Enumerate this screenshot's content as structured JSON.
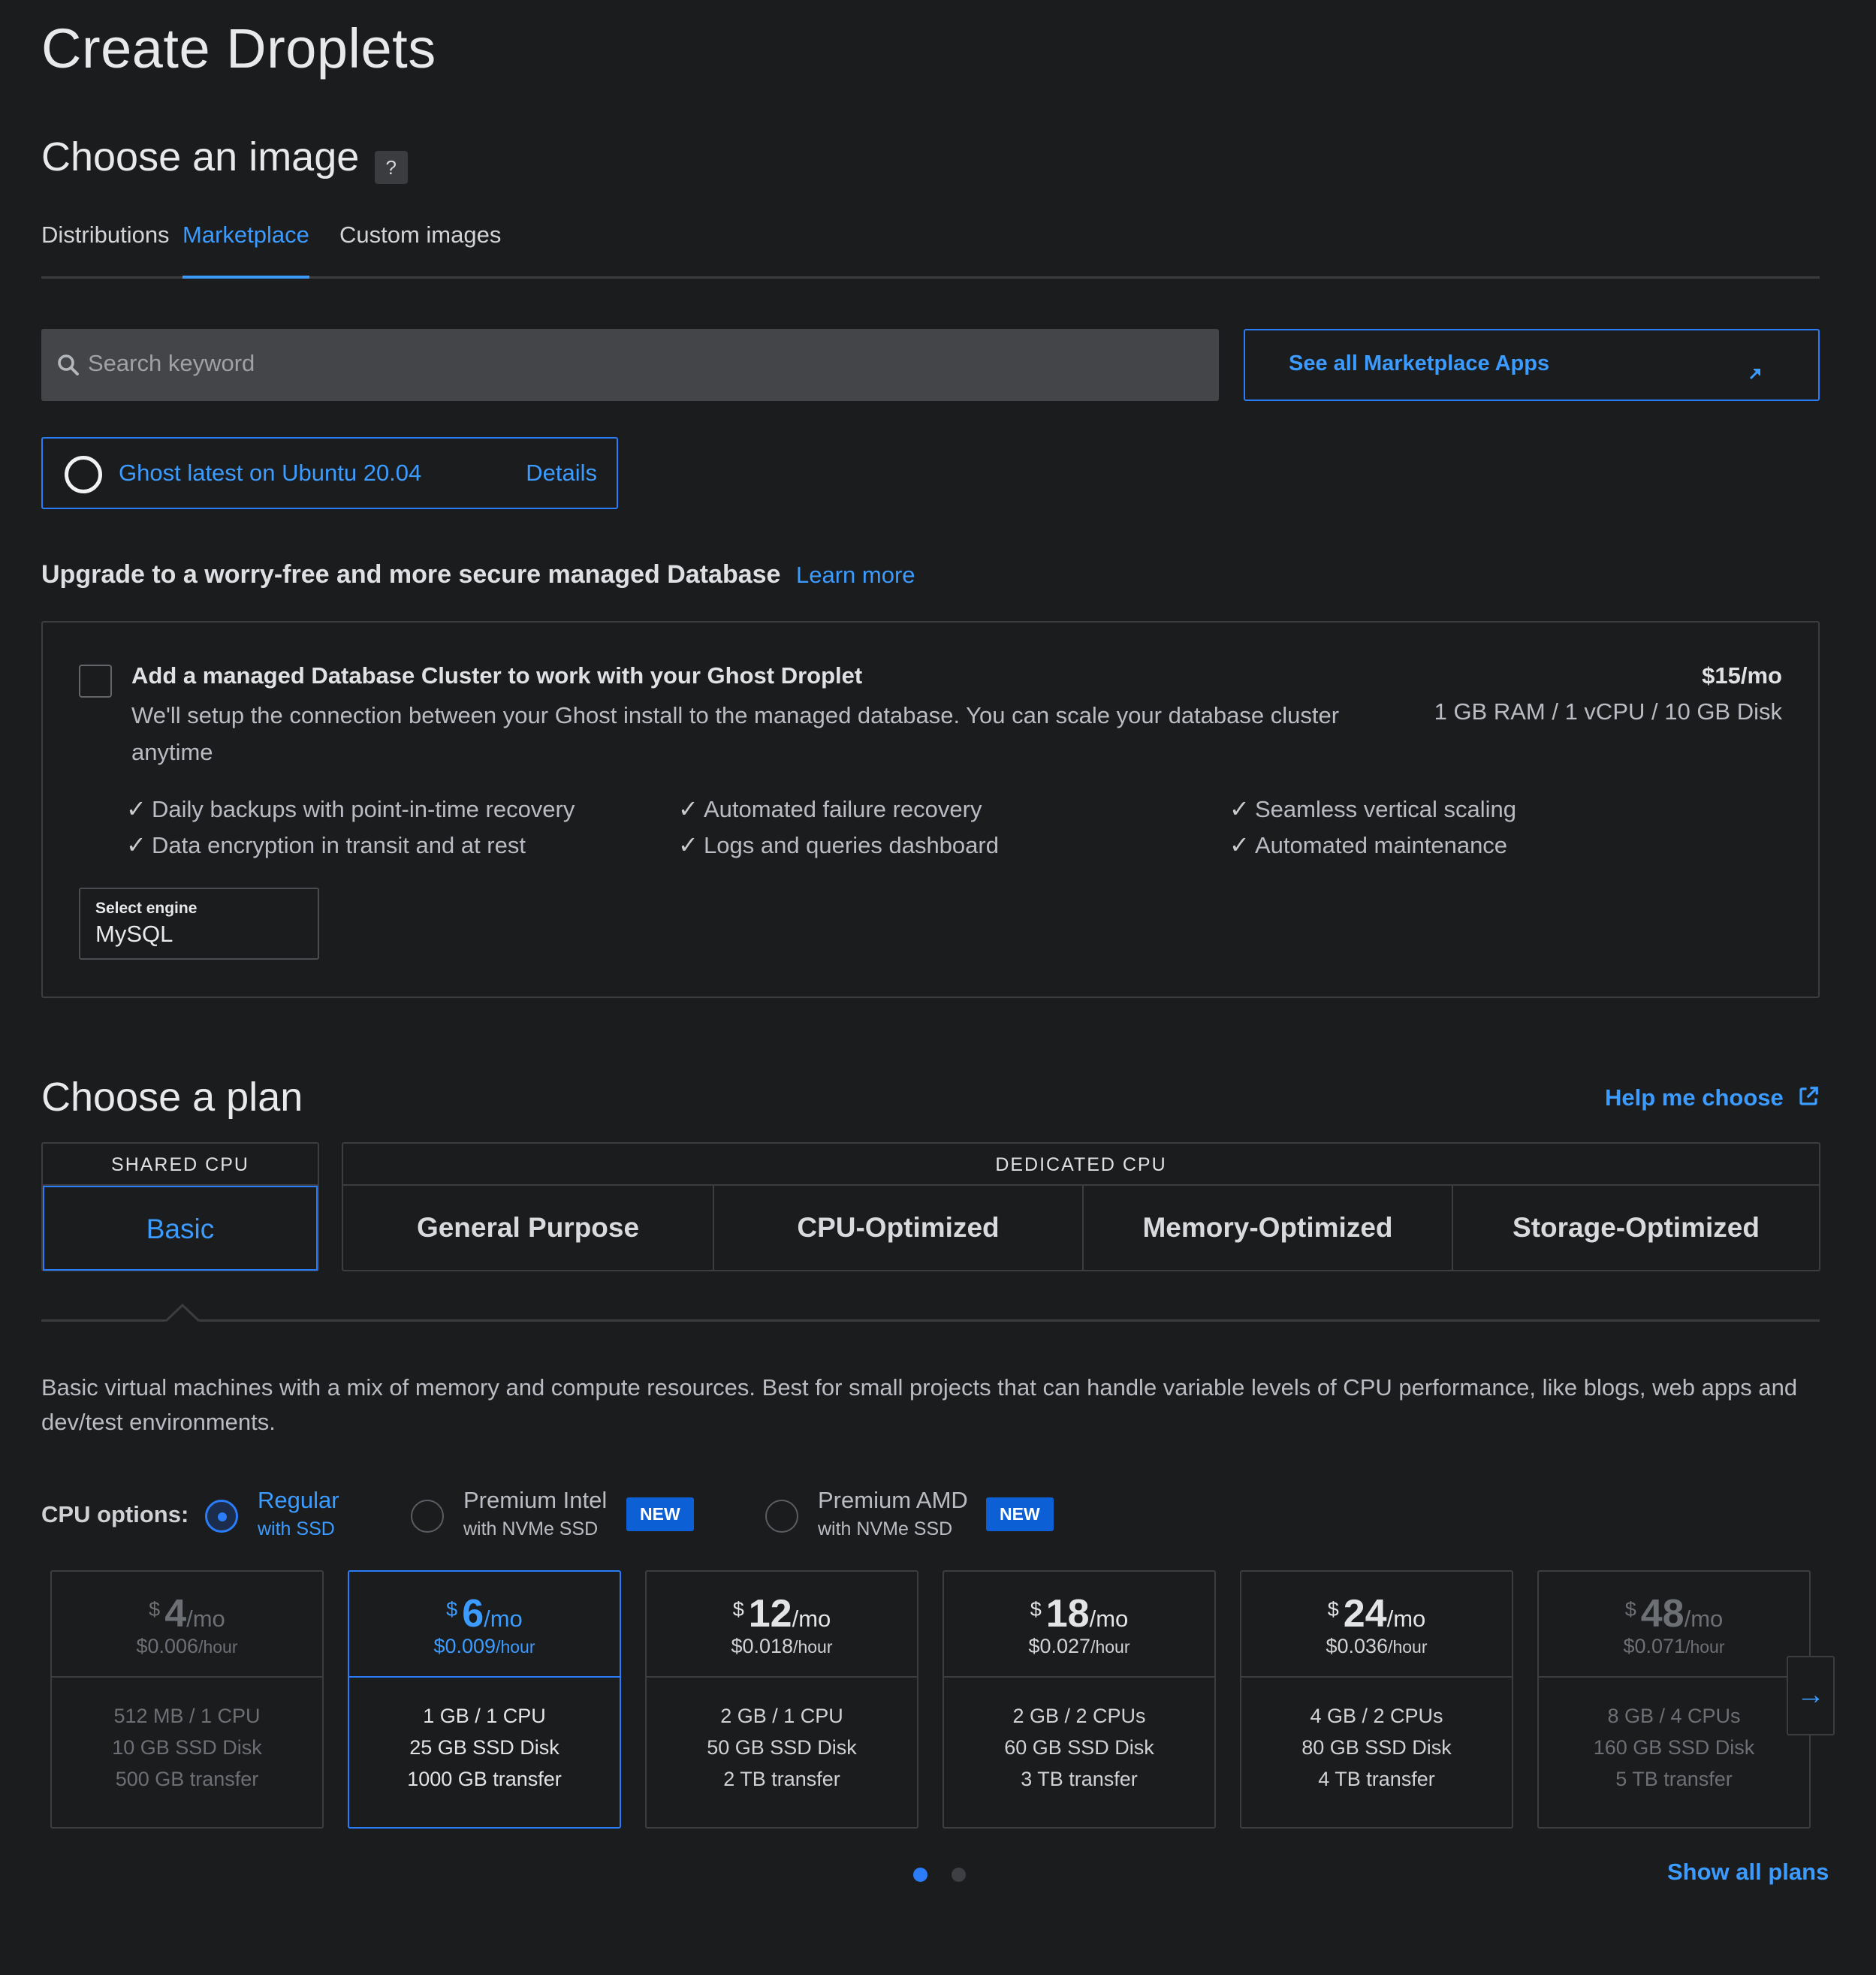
{
  "page": {
    "title": "Create Droplets"
  },
  "image_section": {
    "title": "Choose an image",
    "help": "?",
    "tabs": [
      {
        "label": "Distributions",
        "active": false
      },
      {
        "label": "Marketplace",
        "active": true
      },
      {
        "label": "Custom images",
        "active": false
      }
    ],
    "search_placeholder": "Search keyword",
    "marketplace_button": "See all Marketplace Apps",
    "selected_app": {
      "label": "Ghost latest on Ubuntu 20.04",
      "details": "Details"
    }
  },
  "database_upgrade": {
    "title": "Upgrade to a worry-free and more secure managed Database",
    "learn_more": "Learn more",
    "card_title": "Add a managed Database Cluster to work with your Ghost Droplet",
    "card_desc": "We'll setup the connection between your Ghost install to the managed database. You can scale your database cluster anytime",
    "price": "$15/mo",
    "spec": "1 GB RAM / 1 vCPU / 10 GB Disk",
    "features": [
      "Daily backups with point-in-time recovery",
      "Data encryption in transit and at rest",
      "Automated failure recovery",
      "Logs and queries dashboard",
      "Seamless vertical scaling",
      "Automated maintenance"
    ],
    "engine_label": "Select engine",
    "engine_value": "MySQL"
  },
  "plan_section": {
    "title": "Choose a plan",
    "help_link": "Help me choose",
    "shared_cpu_label": "SHARED CPU",
    "dedicated_cpu_label": "DEDICATED CPU",
    "shared_tabs": [
      "Basic"
    ],
    "dedicated_tabs": [
      "General Purpose",
      "CPU-Optimized",
      "Memory-Optimized",
      "Storage-Optimized"
    ],
    "description": "Basic virtual machines with a mix of memory and compute resources. Best for small projects that can handle variable levels of CPU performance, like blogs, web apps and dev/test environments.",
    "cpu_options_label": "CPU options:",
    "cpu_options": [
      {
        "main": "Regular",
        "sub": "with SSD",
        "selected": true,
        "badge": ""
      },
      {
        "main": "Premium Intel",
        "sub": "with NVMe SSD",
        "selected": false,
        "badge": "NEW"
      },
      {
        "main": "Premium AMD",
        "sub": "with NVMe SSD",
        "selected": false,
        "badge": "NEW"
      }
    ],
    "currency": "$",
    "per_month": "/mo",
    "per_hour": "/hour",
    "plans": [
      {
        "price": "4",
        "hourly": "$0.006",
        "spec1": "512 MB / 1 CPU",
        "spec2": "10 GB SSD Disk",
        "spec3": "500 GB transfer"
      },
      {
        "price": "6",
        "hourly": "$0.009",
        "spec1": "1 GB / 1 CPU",
        "spec2": "25 GB SSD Disk",
        "spec3": "1000 GB transfer"
      },
      {
        "price": "12",
        "hourly": "$0.018",
        "spec1": "2 GB / 1 CPU",
        "spec2": "50 GB SSD Disk",
        "spec3": "2 TB transfer"
      },
      {
        "price": "18",
        "hourly": "$0.027",
        "spec1": "2 GB / 2 CPUs",
        "spec2": "60 GB SSD Disk",
        "spec3": "3 TB transfer"
      },
      {
        "price": "24",
        "hourly": "$0.036",
        "spec1": "4 GB / 2 CPUs",
        "spec2": "80 GB SSD Disk",
        "spec3": "4 TB transfer"
      },
      {
        "price": "48",
        "hourly": "$0.071",
        "spec1": "8 GB / 4 CPUs",
        "spec2": "160 GB SSD Disk",
        "spec3": "5 TB transfer"
      }
    ],
    "next_icon": "arrow-right-icon",
    "show_all": "Show all plans"
  },
  "colors": {
    "accent": "#2a7cf7",
    "link": "#3b9bff",
    "background": "#1b1c1e",
    "border": "#3b3d41"
  }
}
